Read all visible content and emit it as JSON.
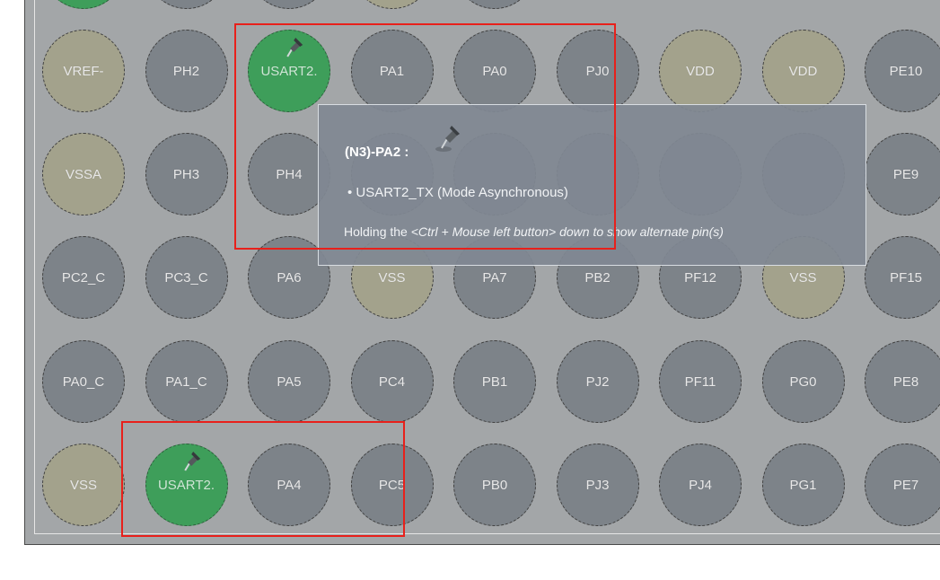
{
  "pin_grid": {
    "partial_top_row": [
      "",
      "",
      "",
      "",
      ""
    ],
    "rows": [
      [
        {
          "label": "VREF-",
          "kind": "power"
        },
        {
          "label": "PH2",
          "kind": "io"
        },
        {
          "label": "USART2.",
          "kind": "assigned",
          "pinned": true
        },
        {
          "label": "PA1",
          "kind": "io"
        },
        {
          "label": "PA0",
          "kind": "io"
        },
        {
          "label": "PJ0",
          "kind": "io"
        },
        {
          "label": "VDD",
          "kind": "power"
        },
        {
          "label": "VDD",
          "kind": "power"
        },
        {
          "label": "PE10",
          "kind": "io"
        }
      ],
      [
        {
          "label": "VSSA",
          "kind": "power"
        },
        {
          "label": "PH3",
          "kind": "io"
        },
        {
          "label": "PH4",
          "kind": "io"
        },
        {
          "label": "",
          "kind": "io"
        },
        {
          "label": "",
          "kind": "io"
        },
        {
          "label": "",
          "kind": "io"
        },
        {
          "label": "",
          "kind": "io"
        },
        {
          "label": "",
          "kind": "io"
        },
        {
          "label": "PE9",
          "kind": "io"
        }
      ],
      [
        {
          "label": "PC2_C",
          "kind": "io"
        },
        {
          "label": "PC3_C",
          "kind": "io"
        },
        {
          "label": "PA6",
          "kind": "io"
        },
        {
          "label": "VSS",
          "kind": "power"
        },
        {
          "label": "PA7",
          "kind": "io"
        },
        {
          "label": "PB2",
          "kind": "io"
        },
        {
          "label": "PF12",
          "kind": "io"
        },
        {
          "label": "VSS",
          "kind": "power"
        },
        {
          "label": "PF15",
          "kind": "io"
        }
      ],
      [
        {
          "label": "PA0_C",
          "kind": "io"
        },
        {
          "label": "PA1_C",
          "kind": "io"
        },
        {
          "label": "PA5",
          "kind": "io"
        },
        {
          "label": "PC4",
          "kind": "io"
        },
        {
          "label": "PB1",
          "kind": "io"
        },
        {
          "label": "PJ2",
          "kind": "io"
        },
        {
          "label": "PF11",
          "kind": "io"
        },
        {
          "label": "PG0",
          "kind": "io"
        },
        {
          "label": "PE8",
          "kind": "io"
        }
      ],
      [
        {
          "label": "VSS",
          "kind": "power"
        },
        {
          "label": "USART2.",
          "kind": "assigned",
          "pinned": true
        },
        {
          "label": "PA4",
          "kind": "io"
        },
        {
          "label": "PC5",
          "kind": "io"
        },
        {
          "label": "PB0",
          "kind": "io"
        },
        {
          "label": "PJ3",
          "kind": "io"
        },
        {
          "label": "PJ4",
          "kind": "io"
        },
        {
          "label": "PG1",
          "kind": "io"
        },
        {
          "label": "PE7",
          "kind": "io"
        }
      ]
    ]
  },
  "tooltip": {
    "title": "(N3)-PA2 :",
    "mode_line": "• USART2_TX (Mode Asynchronous)",
    "hint_prefix": "Holding the ",
    "hint_keys": "<Ctrl + Mouse left button>",
    "hint_suffix": " down to show alternate pin(s)",
    "icon": "pushpin-icon"
  },
  "colors": {
    "panel_bg": "#a3a6a8",
    "io_pin": "#7d8389",
    "power_pin": "#a3a28c",
    "assigned_pin": "#3e9e5a",
    "highlight": "#e8201b"
  }
}
